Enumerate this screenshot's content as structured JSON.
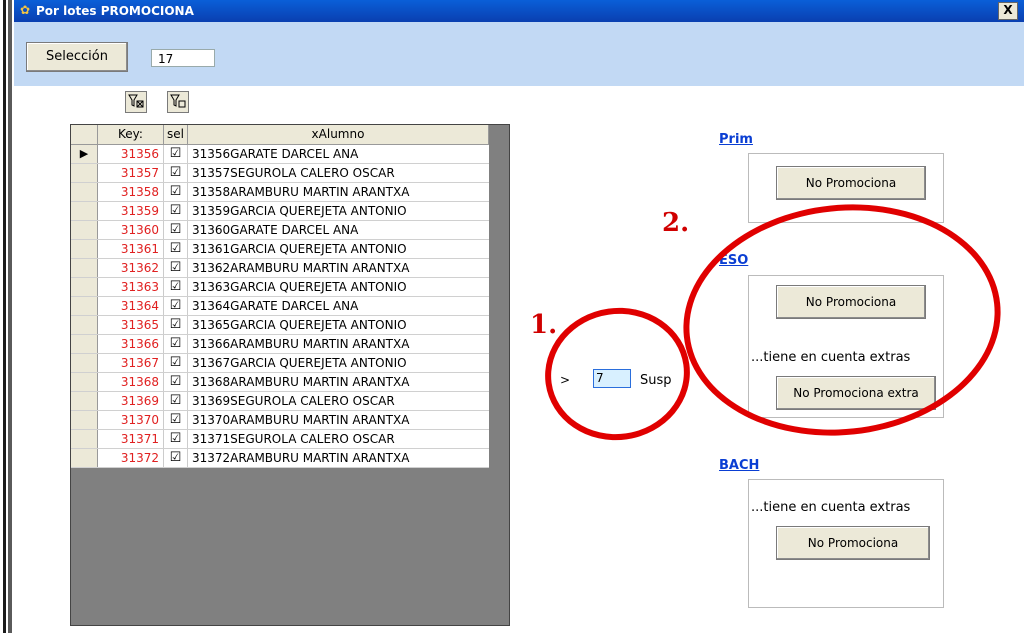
{
  "window": {
    "title": "Por lotes PROMOCIONA",
    "close_label": "X"
  },
  "header": {
    "selection_button_label": "Selección",
    "count_value": "17"
  },
  "toolbar": {
    "filter_apply_icon": "filter-clear-icon",
    "filter_remove_icon": "filter-icon"
  },
  "grid": {
    "columns": [
      "Key:",
      "sel",
      "xAlumno"
    ],
    "rows": [
      {
        "key": "31356",
        "checked": true,
        "name": "31356GARATE DARCEL ANA"
      },
      {
        "key": "31357",
        "checked": true,
        "name": "31357SEGUROLA CALERO OSCAR"
      },
      {
        "key": "31358",
        "checked": true,
        "name": "31358ARAMBURU MARTIN ARANTXA"
      },
      {
        "key": "31359",
        "checked": true,
        "name": "31359GARCIA QUEREJETA ANTONIO"
      },
      {
        "key": "31360",
        "checked": true,
        "name": "31360GARATE DARCEL ANA"
      },
      {
        "key": "31361",
        "checked": true,
        "name": "31361GARCIA QUEREJETA ANTONIO"
      },
      {
        "key": "31362",
        "checked": true,
        "name": "31362ARAMBURU MARTIN ARANTXA"
      },
      {
        "key": "31363",
        "checked": true,
        "name": "31363GARCIA QUEREJETA ANTONIO"
      },
      {
        "key": "31364",
        "checked": true,
        "name": "31364GARATE DARCEL ANA"
      },
      {
        "key": "31365",
        "checked": true,
        "name": "31365GARCIA QUEREJETA ANTONIO"
      },
      {
        "key": "31366",
        "checked": true,
        "name": "31366ARAMBURU MARTIN ARANTXA"
      },
      {
        "key": "31367",
        "checked": true,
        "name": "31367GARCIA QUEREJETA ANTONIO"
      },
      {
        "key": "31368",
        "checked": true,
        "name": "31368ARAMBURU MARTIN ARANTXA"
      },
      {
        "key": "31369",
        "checked": true,
        "name": "31369SEGUROLA CALERO OSCAR"
      },
      {
        "key": "31370",
        "checked": true,
        "name": "31370ARAMBURU MARTIN ARANTXA"
      },
      {
        "key": "31371",
        "checked": true,
        "name": "31371SEGUROLA CALERO OSCAR"
      },
      {
        "key": "31372",
        "checked": true,
        "name": "31372ARAMBURU MARTIN ARANTXA"
      }
    ],
    "current_row_indicator": "▶"
  },
  "susp": {
    "prefix": ">",
    "value": "7",
    "suffix": "Susp"
  },
  "annotations": {
    "one": "1.",
    "two": "2."
  },
  "sections": {
    "prim": {
      "link": "Prim",
      "button": "No Promociona"
    },
    "eso": {
      "link": "ESO",
      "button": "No Promociona",
      "note": "...tiene en cuenta extras",
      "extra_button": "No Promociona extra"
    },
    "bach": {
      "link": "BACH",
      "note": "...tiene en cuenta extras",
      "button": "No Promociona"
    }
  },
  "colors": {
    "title_bar": "#0a4fd0",
    "header_band": "#c2d9f4",
    "key_text": "#e02020",
    "link": "#0a3ed3",
    "annotation_red": "#e00000"
  }
}
